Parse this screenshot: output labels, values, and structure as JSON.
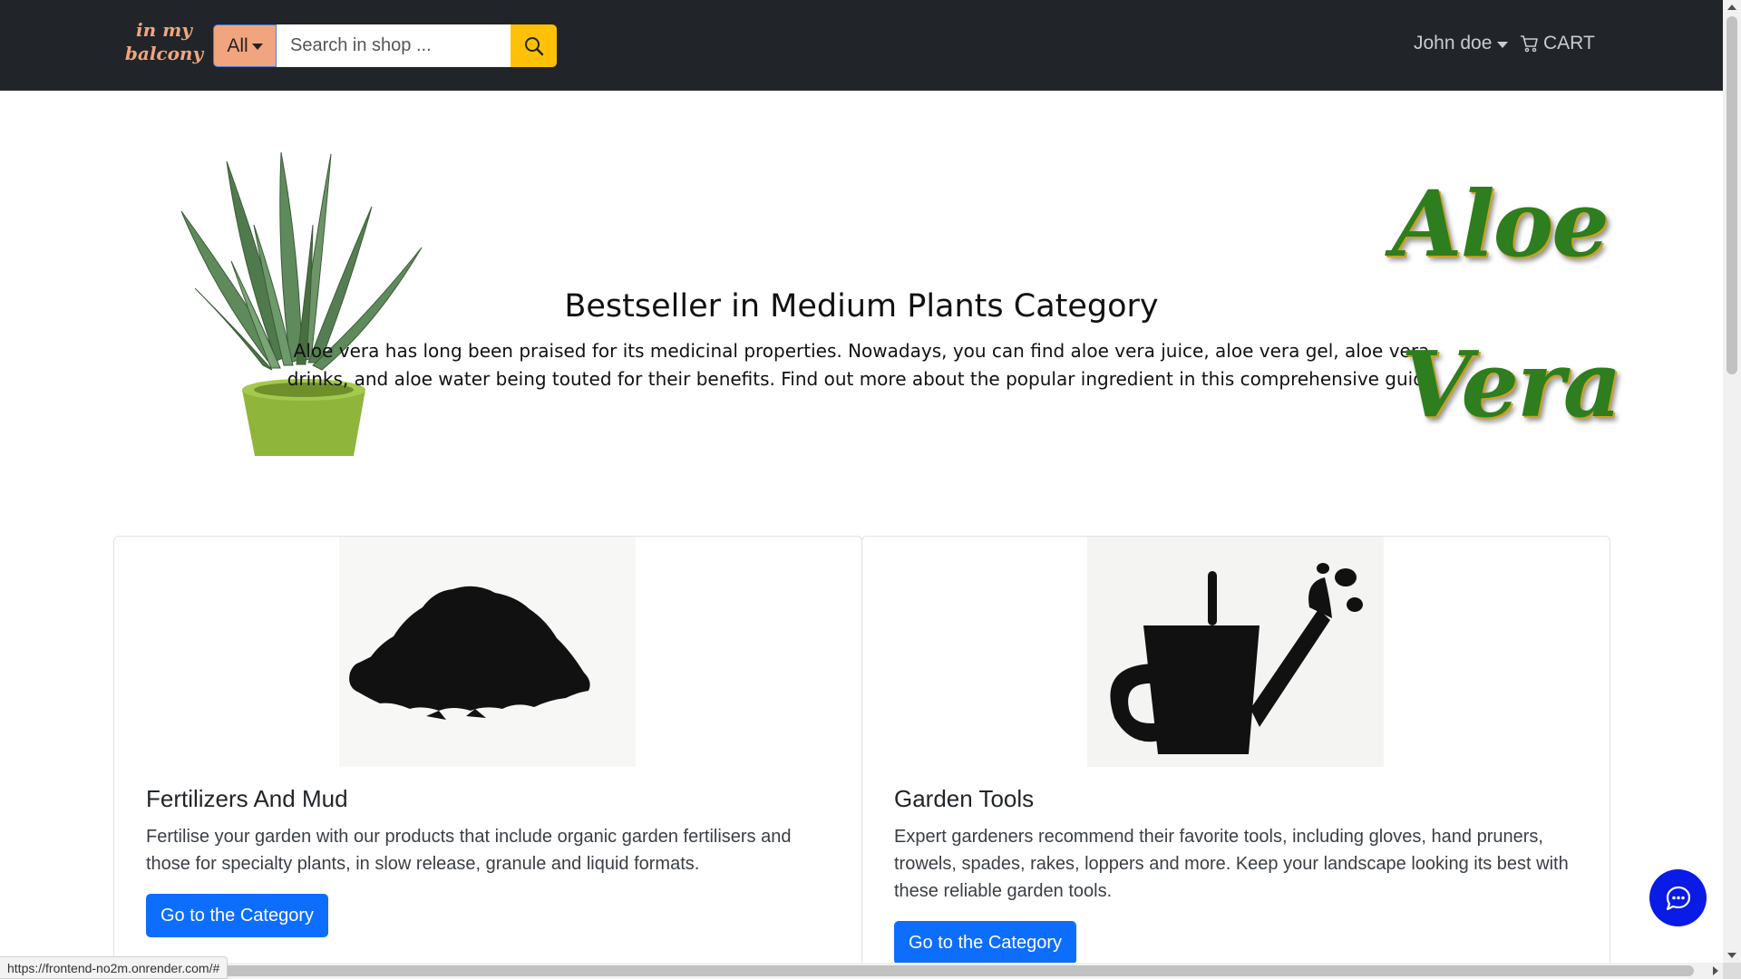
{
  "navbar": {
    "logo_line1": "in my",
    "logo_line2": "balcony",
    "category_label": "All",
    "search_placeholder": "Search in shop ...",
    "search_icon": "search-icon",
    "user_name": "John doe",
    "cart_label": "CART",
    "cart_icon": "cart-icon"
  },
  "hero": {
    "title": "Bestseller in Medium Plants Category",
    "description": "Aloe vera has long been praised for its medicinal properties. Nowadays, you can find aloe vera juice, aloe vera gel, aloe vera drinks, and aloe water being touted for their benefits. Find out more about the popular ingredient in this comprehensive guide",
    "brand_word1": "Aloe",
    "brand_word2": "Vera"
  },
  "cards": [
    {
      "title": "Fertilizers And Mud",
      "text": "Fertilise your garden with our products that include organic garden fertilisers and those for specialty plants, in slow release, granule and liquid formats.",
      "button": "Go to the Category",
      "image": "soil-pile-icon"
    },
    {
      "title": "Garden Tools",
      "text": "Expert gardeners recommend their favorite tools, including gloves, hand pruners, trowels, spades, rakes, loppers and more. Keep your landscape looking its best with these reliable garden tools.",
      "button": "Go to the Category",
      "image": "watering-can-icon"
    }
  ],
  "status_bar": {
    "url": "https://frontend-no2m.onrender.com/#"
  },
  "chat": {
    "icon": "chat-icon"
  },
  "colors": {
    "navbar_bg": "#212529",
    "logo": "#f0a57e",
    "search_button": "#ffc107",
    "primary_button": "#0d6efd",
    "chat_button": "#0a1be6",
    "aloe_text": "#2e7d1e"
  }
}
